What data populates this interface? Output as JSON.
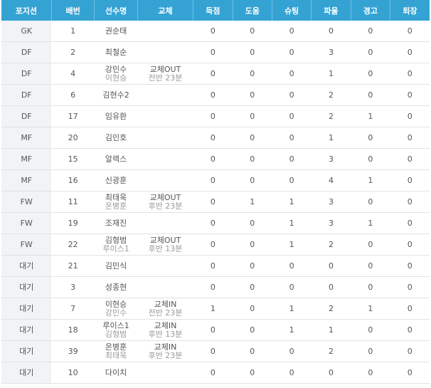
{
  "headers": [
    "포지션",
    "배번",
    "선수명",
    "교체",
    "득점",
    "도움",
    "슈팅",
    "파울",
    "경고",
    "퇴장"
  ],
  "rows": [
    {
      "pos": "GK",
      "num": "1",
      "name": "권순태",
      "name2": "",
      "sub1": "",
      "sub2": "",
      "goals": "0",
      "assists": "0",
      "shots": "0",
      "fouls": "0",
      "yellow": "0",
      "red": "0"
    },
    {
      "pos": "DF",
      "num": "2",
      "name": "최철순",
      "name2": "",
      "sub1": "",
      "sub2": "",
      "goals": "0",
      "assists": "0",
      "shots": "0",
      "fouls": "3",
      "yellow": "0",
      "red": "0"
    },
    {
      "pos": "DF",
      "num": "4",
      "name": "강민수",
      "name2": "이현승",
      "sub1": "교체OUT",
      "sub2": "전반 23분",
      "goals": "0",
      "assists": "0",
      "shots": "0",
      "fouls": "1",
      "yellow": "0",
      "red": "0"
    },
    {
      "pos": "DF",
      "num": "6",
      "name": "김현수2",
      "name2": "",
      "sub1": "",
      "sub2": "",
      "goals": "0",
      "assists": "0",
      "shots": "0",
      "fouls": "2",
      "yellow": "0",
      "red": "0"
    },
    {
      "pos": "DF",
      "num": "17",
      "name": "임유환",
      "name2": "",
      "sub1": "",
      "sub2": "",
      "goals": "0",
      "assists": "0",
      "shots": "0",
      "fouls": "2",
      "yellow": "1",
      "red": "0"
    },
    {
      "pos": "MF",
      "num": "20",
      "name": "김인호",
      "name2": "",
      "sub1": "",
      "sub2": "",
      "goals": "0",
      "assists": "0",
      "shots": "0",
      "fouls": "1",
      "yellow": "0",
      "red": "0"
    },
    {
      "pos": "MF",
      "num": "15",
      "name": "알렉스",
      "name2": "",
      "sub1": "",
      "sub2": "",
      "goals": "0",
      "assists": "0",
      "shots": "0",
      "fouls": "3",
      "yellow": "0",
      "red": "0"
    },
    {
      "pos": "MF",
      "num": "16",
      "name": "신광훈",
      "name2": "",
      "sub1": "",
      "sub2": "",
      "goals": "0",
      "assists": "0",
      "shots": "0",
      "fouls": "4",
      "yellow": "1",
      "red": "0"
    },
    {
      "pos": "FW",
      "num": "11",
      "name": "최태욱",
      "name2": "온병훈",
      "sub1": "교체OUT",
      "sub2": "후반 23분",
      "goals": "0",
      "assists": "1",
      "shots": "1",
      "fouls": "3",
      "yellow": "0",
      "red": "0"
    },
    {
      "pos": "FW",
      "num": "19",
      "name": "조재진",
      "name2": "",
      "sub1": "",
      "sub2": "",
      "goals": "0",
      "assists": "0",
      "shots": "1",
      "fouls": "3",
      "yellow": "1",
      "red": "0"
    },
    {
      "pos": "FW",
      "num": "22",
      "name": "김형범",
      "name2": "루이스1",
      "sub1": "교체OUT",
      "sub2": "후반 13분",
      "goals": "0",
      "assists": "0",
      "shots": "1",
      "fouls": "2",
      "yellow": "0",
      "red": "0"
    },
    {
      "pos": "대기",
      "num": "21",
      "name": "김민식",
      "name2": "",
      "sub1": "",
      "sub2": "",
      "goals": "0",
      "assists": "0",
      "shots": "0",
      "fouls": "0",
      "yellow": "0",
      "red": "0"
    },
    {
      "pos": "대기",
      "num": "3",
      "name": "성종현",
      "name2": "",
      "sub1": "",
      "sub2": "",
      "goals": "0",
      "assists": "0",
      "shots": "0",
      "fouls": "0",
      "yellow": "0",
      "red": "0"
    },
    {
      "pos": "대기",
      "num": "7",
      "name": "이현승",
      "name2": "강민수",
      "sub1": "교체IN",
      "sub2": "전반 23분",
      "goals": "1",
      "assists": "0",
      "shots": "1",
      "fouls": "2",
      "yellow": "1",
      "red": "0"
    },
    {
      "pos": "대기",
      "num": "18",
      "name": "루이스1",
      "name2": "김형범",
      "sub1": "교체IN",
      "sub2": "후반 13분",
      "goals": "0",
      "assists": "0",
      "shots": "1",
      "fouls": "1",
      "yellow": "0",
      "red": "0"
    },
    {
      "pos": "대기",
      "num": "39",
      "name": "온병훈",
      "name2": "최태욱",
      "sub1": "교체IN",
      "sub2": "후반 23분",
      "goals": "0",
      "assists": "0",
      "shots": "0",
      "fouls": "2",
      "yellow": "0",
      "red": "0"
    },
    {
      "pos": "대기",
      "num": "10",
      "name": "다이치",
      "name2": "",
      "sub1": "",
      "sub2": "",
      "goals": "0",
      "assists": "0",
      "shots": "0",
      "fouls": "0",
      "yellow": "0",
      "red": "0"
    }
  ]
}
